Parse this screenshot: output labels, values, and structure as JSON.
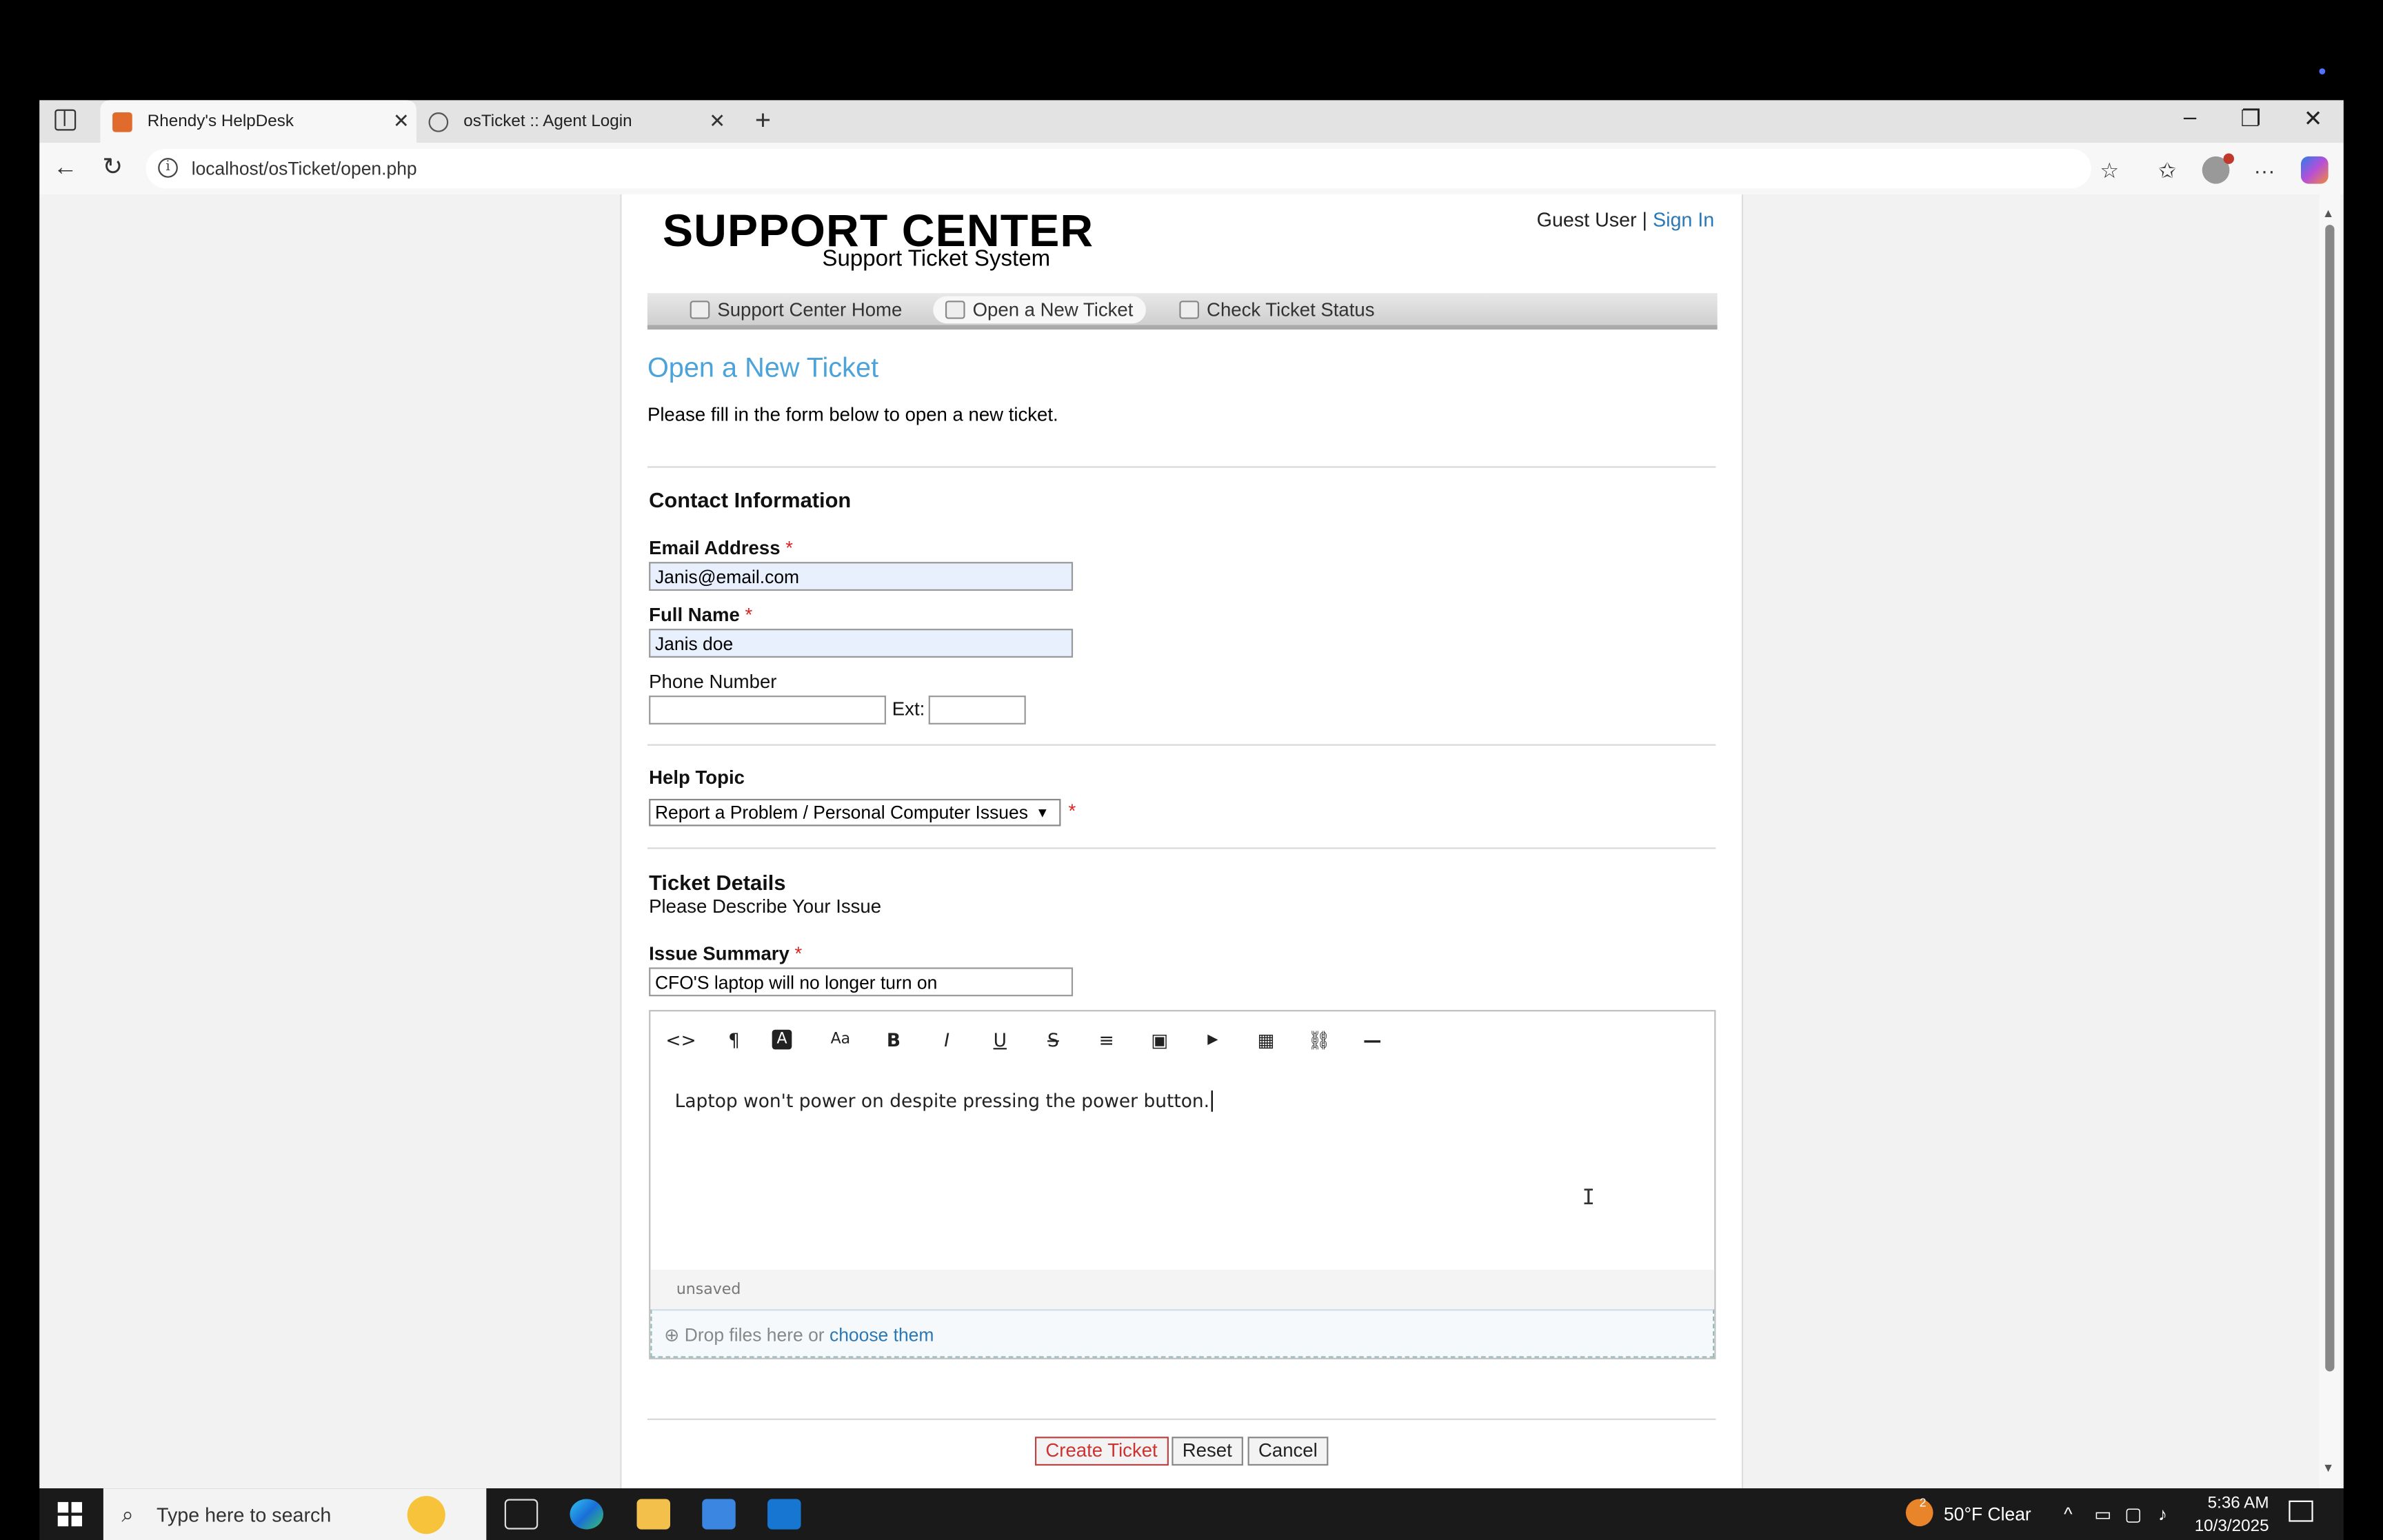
{
  "browser": {
    "tabs": [
      {
        "label": "Rhendy's HelpDesk",
        "active": true,
        "favicon_color": "#e06b2d"
      },
      {
        "label": "osTicket :: Agent Login",
        "active": false,
        "favicon_color": "#666666"
      }
    ],
    "url": "localhost/osTicket/open.php",
    "icons": [
      "sidebar-icon",
      "new-tab-icon",
      "minimize-icon",
      "restore-icon",
      "close-icon",
      "back-icon",
      "reload-icon",
      "info-icon",
      "star-icon",
      "favorites-icon",
      "profile-icon",
      "more-icon",
      "copilot-icon"
    ]
  },
  "header": {
    "logo_title": "SUPPORT CENTER",
    "logo_subtitle": "Support Ticket System",
    "guest_label": "Guest User |",
    "sign_in": "Sign In"
  },
  "nav": {
    "items": [
      {
        "label": "Support Center Home",
        "active": false
      },
      {
        "label": "Open a New Ticket",
        "active": true
      },
      {
        "label": "Check Ticket Status",
        "active": false
      }
    ]
  },
  "main": {
    "title": "Open a New Ticket",
    "intro": "Please fill in the form below to open a new ticket."
  },
  "contact": {
    "title": "Contact Information",
    "email_label": "Email Address",
    "email_value": "Janis@email.com",
    "name_label": "Full Name",
    "name_value": "Janis doe",
    "phone_label": "Phone Number",
    "phone_value": "",
    "ext_label": "Ext:",
    "ext_value": "",
    "required_mark": "*"
  },
  "help_topic": {
    "title": "Help Topic",
    "selected": "Report a Problem / Personal Computer Issues"
  },
  "ticket": {
    "title": "Ticket Details",
    "subtitle": "Please Describe Your Issue",
    "summary_label": "Issue Summary",
    "summary_value": "CFO'S laptop will no longer turn on",
    "body_text": "Laptop won't power on despite pressing the power button.",
    "status": "unsaved",
    "drop_text": "Drop files here or",
    "drop_link": "choose them"
  },
  "toolbar": {
    "tools": [
      "<>",
      "¶",
      "A",
      "Aa",
      "B",
      "I",
      "U",
      "S",
      "≡",
      "▣",
      "▶",
      "▦",
      "⛓",
      "—"
    ],
    "tool_names": [
      "code-view-icon",
      "paragraph-icon",
      "font-color-icon",
      "font-size-icon",
      "bold-icon",
      "italic-icon",
      "underline-icon",
      "strikethrough-icon",
      "list-icon",
      "image-icon",
      "video-icon",
      "table-icon",
      "link-icon",
      "horizontal-rule-icon"
    ]
  },
  "actions": {
    "create": "Create Ticket",
    "reset": "Reset",
    "cancel": "Cancel"
  },
  "taskbar": {
    "search_placeholder": "Type here to search",
    "weather": "50°F  Clear",
    "weather_badge": "2",
    "time": "5:36 AM",
    "date": "10/3/2025"
  },
  "colors": {
    "accent_link": "#2a78b5",
    "title_blue": "#4ba3d9",
    "required_red": "#dd2222",
    "primary_button_text": "#cc3333"
  }
}
